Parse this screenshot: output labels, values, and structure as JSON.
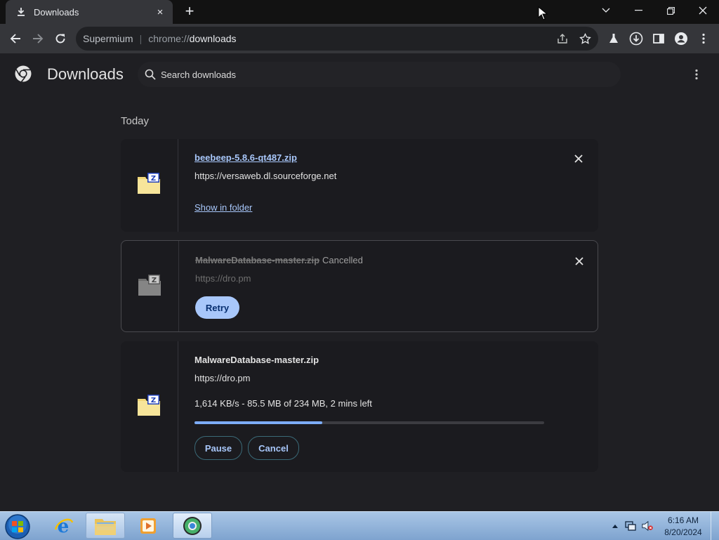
{
  "tab": {
    "title": "Downloads",
    "icon": "download-icon",
    "close": "×",
    "new_tab": "+"
  },
  "window_controls": [
    "chevron-down-icon",
    "minimize-icon",
    "restore-icon",
    "close-icon"
  ],
  "omnibox": {
    "site_name": "Supermium",
    "scheme": "chrome://",
    "path": "downloads"
  },
  "toolbar_icons": [
    "share-icon",
    "bookmark-star-icon",
    "labs-flask-icon",
    "download-icon",
    "side-panel-icon",
    "profile-icon",
    "more-vert-icon"
  ],
  "page": {
    "title": "Downloads",
    "search_placeholder": "Search downloads",
    "section": "Today"
  },
  "downloads": [
    {
      "filename": "beebeep-5.8.6-qt487.zip",
      "url": "https://versaweb.dl.sourceforge.net",
      "action": "Show in folder",
      "state": "complete"
    },
    {
      "filename": "MalwareDatabase-master.zip",
      "status": "Cancelled",
      "url": "https://dro.pm",
      "action": "Retry",
      "state": "cancelled"
    },
    {
      "filename": "MalwareDatabase-master.zip",
      "url": "https://dro.pm",
      "progress_text": "1,614 KB/s - 85.5 MB of 234 MB, 2 mins left",
      "progress_fraction": 0.365,
      "pause": "Pause",
      "cancel": "Cancel",
      "state": "in-progress"
    }
  ],
  "taskbar": {
    "apps": [
      "internet-explorer-icon",
      "file-explorer-icon",
      "media-player-icon",
      "supermium-browser-icon"
    ],
    "tray": [
      "show-hidden-icons",
      "network-icon",
      "volume-muted-icon"
    ],
    "time": "6:16 AM",
    "date": "8/20/2024"
  },
  "colors": {
    "accent": "#a8c7fa",
    "progress": "#7cacf8",
    "background": "#1f1f23"
  }
}
